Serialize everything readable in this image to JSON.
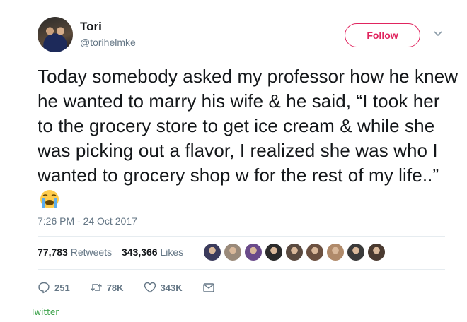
{
  "tweet": {
    "name": "Tori",
    "handle": "@torihelmke",
    "follow_label": "Follow",
    "text": "Today somebody asked my professor how he knew he wanted to marry his wife & he said, “I took her to the grocery store to get ice cream & while she was picking out a flavor, I realized she was who I wanted to grocery shop w for the rest of my life..”",
    "emoji": "loudly-crying-face",
    "timestamp": "7:26 PM - 24 Oct 2017"
  },
  "stats": {
    "retweets_count": "77,783",
    "retweets_label": "Retweets",
    "likes_count": "343,366",
    "likes_label": "Likes",
    "liker_colors": [
      "#3b3b5c",
      "#9a8a7a",
      "#6a4a8a",
      "#2b2b2b",
      "#5a4a40",
      "#6b5040",
      "#b08a6a",
      "#3a3a3a",
      "#4a3a30"
    ]
  },
  "actions": {
    "reply_count": "251",
    "retweet_count": "78K",
    "like_count": "343K"
  },
  "source_label": "Twitter",
  "colors": {
    "follow_accent": "#e0245e",
    "secondary_text": "#657786",
    "primary_text": "#14171a"
  }
}
